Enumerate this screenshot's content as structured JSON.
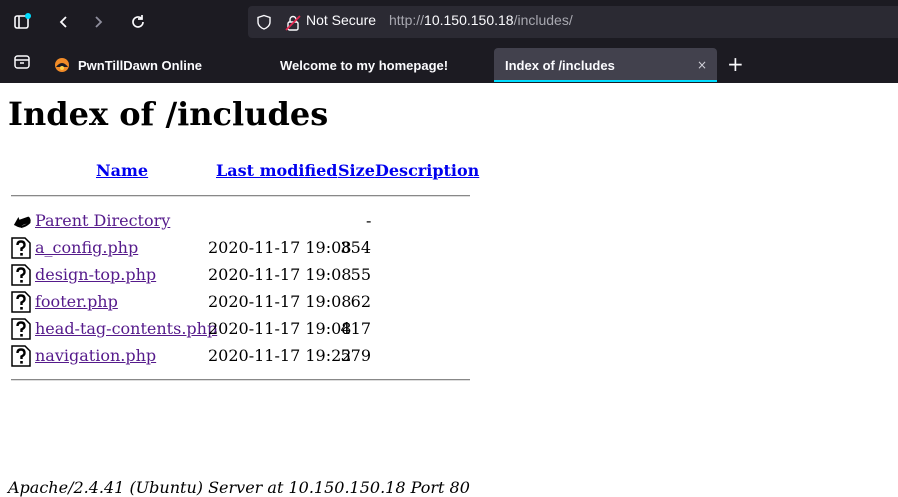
{
  "browser": {
    "security_label": "Not Secure",
    "url_prefix": "http://",
    "url_host": "10.150.150.18",
    "url_path": "/includes/",
    "tabs": [
      {
        "label": "PwnTillDawn Online"
      },
      {
        "label": "Welcome to my homepage!"
      },
      {
        "label": "Index of /includes",
        "close": "×"
      }
    ],
    "new_tab": "+"
  },
  "page": {
    "title": "Index of /includes",
    "columns": {
      "name": "Name",
      "modified": "Last modified",
      "size": "Size",
      "description": "Description"
    },
    "parent": {
      "name": "Parent Directory",
      "size": "-"
    },
    "files": [
      {
        "name": "a_config.php",
        "modified": "2020-11-17 19:08",
        "size": "354"
      },
      {
        "name": "design-top.php",
        "modified": "2020-11-17 19:08",
        "size": "55"
      },
      {
        "name": "footer.php",
        "modified": "2020-11-17 19:08",
        "size": "62"
      },
      {
        "name": "head-tag-contents.php",
        "modified": "2020-11-17 19:08",
        "size": "417"
      },
      {
        "name": "navigation.php",
        "modified": "2020-11-17 19:22",
        "size": "579"
      }
    ],
    "footer": "Apache/2.4.41 (Ubuntu) Server at 10.150.150.18 Port 80"
  }
}
